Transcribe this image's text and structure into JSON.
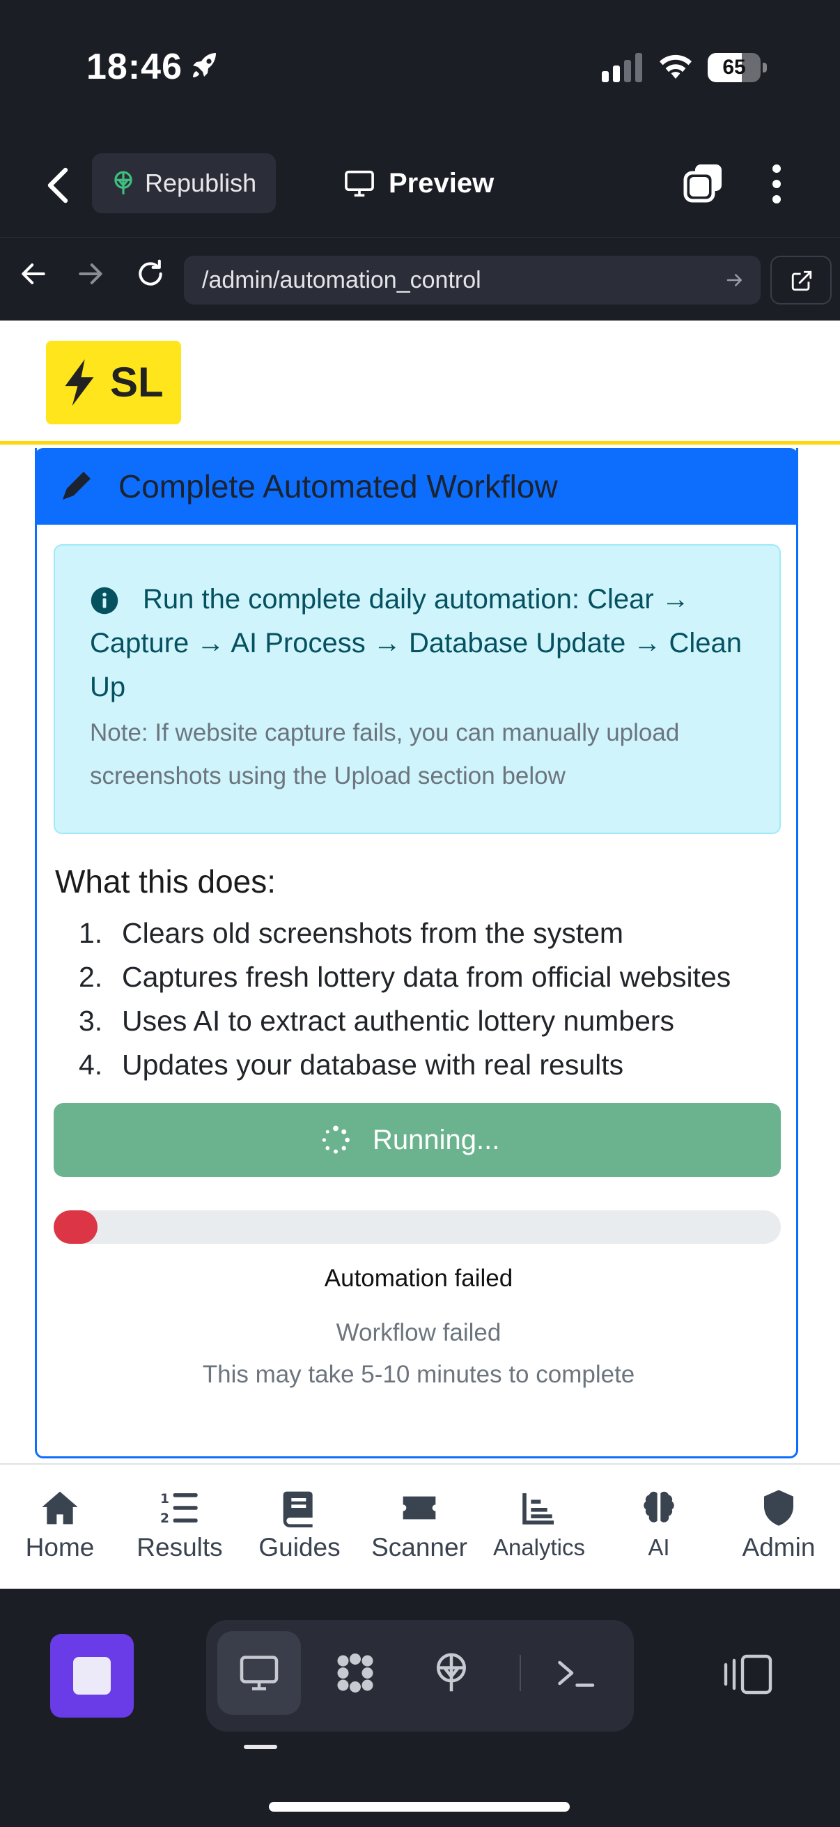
{
  "status_bar": {
    "time": "18:46",
    "battery_percent": "65",
    "battery_level": 0.65
  },
  "toolbar": {
    "republish_label": "Republish",
    "preview_label": "Preview"
  },
  "browser": {
    "url": "/admin/automation_control"
  },
  "site": {
    "logo_text": "SL",
    "brand_color": "#ffe51c"
  },
  "card": {
    "title": "Complete Automated Workflow",
    "info_text": "Run the complete daily automation: Clear → Capture → AI Process → Database Update → Clean Up",
    "note_text": "Note: If website capture fails, you can manually upload screenshots using the Upload section below",
    "section_title": "What this does:",
    "steps": [
      "Clears old screenshots from the system",
      "Captures fresh lottery data from official websites",
      "Uses AI to extract authentic lottery numbers",
      "Updates your database with real results"
    ],
    "run_button_label": "Running...",
    "progress_fraction": 0.06,
    "status": "Automation failed",
    "status_detail": "Workflow failed",
    "duration_note": "This may take 5-10 minutes to complete",
    "colors": {
      "header": "#0d6efd",
      "button": "#6bb38f",
      "progress": "#dc3545"
    }
  },
  "bottom_nav": {
    "items": [
      {
        "label": "Home",
        "icon": "home-icon"
      },
      {
        "label": "Results",
        "icon": "list-ordered-icon"
      },
      {
        "label": "Guides",
        "icon": "book-icon"
      },
      {
        "label": "Scanner",
        "icon": "ticket-icon"
      },
      {
        "label": "Analytics",
        "icon": "chart-icon"
      },
      {
        "label": "AI",
        "icon": "brain-icon"
      },
      {
        "label": "Admin",
        "icon": "shield-icon"
      }
    ]
  },
  "dock": {
    "accent_color": "#6a3ce8",
    "items": [
      "preview-icon",
      "agent-icon",
      "deploy-icon",
      "shell-icon"
    ]
  }
}
